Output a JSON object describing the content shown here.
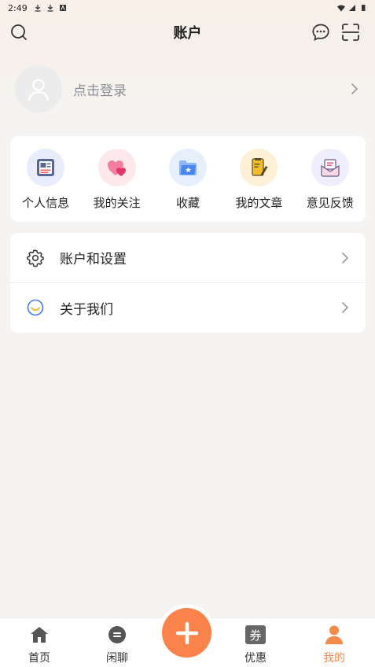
{
  "status_bar": {
    "time": "2:49"
  },
  "header": {
    "title": "账户"
  },
  "login": {
    "prompt": "点击登录"
  },
  "quick_actions": [
    {
      "label": "个人信息",
      "icon": "profile-card-icon",
      "bg": "#e9ecfb"
    },
    {
      "label": "我的关注",
      "icon": "hearts-icon",
      "bg": "#fde8ec"
    },
    {
      "label": "收藏",
      "icon": "star-folder-icon",
      "bg": "#e6f0fd"
    },
    {
      "label": "我的文章",
      "icon": "article-pen-icon",
      "bg": "#fdf0d6"
    },
    {
      "label": "意见反馈",
      "icon": "feedback-mail-icon",
      "bg": "#efeefc"
    }
  ],
  "settings": [
    {
      "label": "账户和设置",
      "icon": "gear-icon"
    },
    {
      "label": "关于我们",
      "icon": "smile-icon"
    }
  ],
  "bottom_nav": {
    "items": [
      {
        "label": "首页",
        "icon": "home-icon"
      },
      {
        "label": "闲聊",
        "icon": "chat-icon"
      },
      {
        "label": "优惠",
        "icon": "coupon-icon",
        "badge_char": "券"
      },
      {
        "label": "我的",
        "icon": "person-icon",
        "active": true
      }
    ]
  },
  "colors": {
    "accent": "#f9834a",
    "active_tab": "#f58a4b",
    "background": "#f5f4f2"
  }
}
